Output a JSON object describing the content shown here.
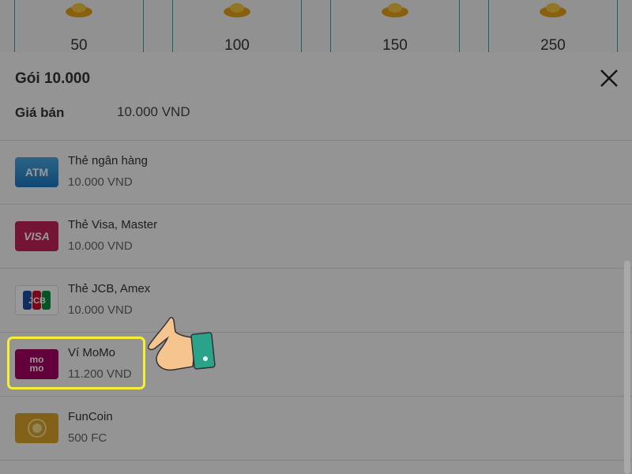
{
  "packages": [
    {
      "amount": "50"
    },
    {
      "amount": "100"
    },
    {
      "amount": "150"
    },
    {
      "amount": "250"
    }
  ],
  "modal": {
    "title": "Gói 10.000",
    "price_label": "Giá bán",
    "price_value": "10.000 VND"
  },
  "payment_methods": [
    {
      "logo_text": "ATM",
      "name": "Thẻ ngân hàng",
      "price": "10.000 VND",
      "icon": "atm-card-icon"
    },
    {
      "logo_text": "VISA",
      "name": "Thẻ Visa, Master",
      "price": "10.000 VND",
      "icon": "visa-card-icon"
    },
    {
      "logo_text": "JCB",
      "name": "Thẻ JCB, Amex",
      "price": "10.000 VND",
      "icon": "jcb-card-icon"
    },
    {
      "logo_text_top": "mo",
      "logo_text_bottom": "mo",
      "name": "Ví MoMo",
      "price": "11.200 VND",
      "icon": "momo-wallet-icon"
    },
    {
      "name": "FunCoin",
      "price": "500 FC",
      "icon": "funcoin-icon"
    }
  ],
  "colors": {
    "highlight": "#f5ef3a",
    "momo": "#a50064",
    "visa": "#c2245a",
    "atm": "#1c78c2",
    "funcoin": "#d9a32a",
    "hand_cuff": "#2aa38a"
  }
}
